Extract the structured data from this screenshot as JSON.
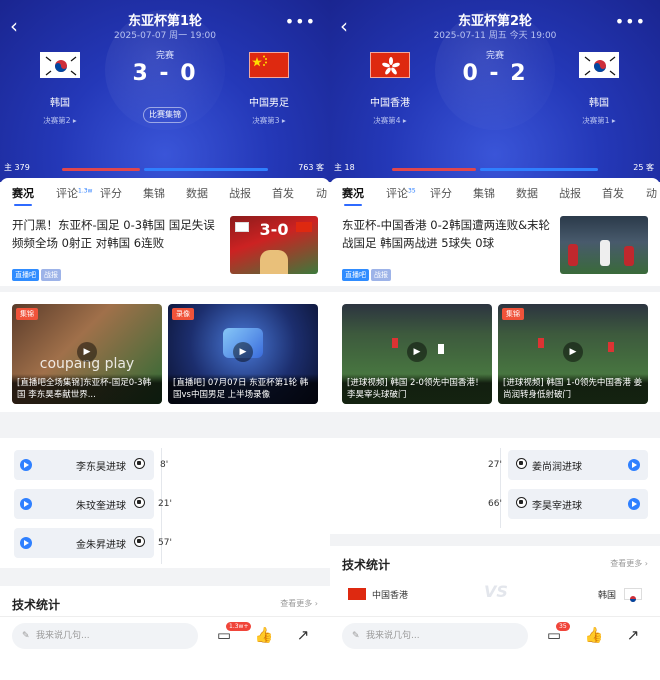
{
  "panels": [
    {
      "header": {
        "title": "东亚杯第1轮",
        "date": "2025-07-07 周一 19:00",
        "status": "完赛",
        "score": "3 - 0",
        "highlights": "比赛集锦",
        "home": {
          "name": "韩国",
          "sub": "决赛第2 ▸",
          "flag": "korea"
        },
        "away": {
          "name": "中国男足",
          "sub": "决赛第3 ▸",
          "flag": "china"
        }
      },
      "votes": {
        "left": "主 379",
        "right": "763 客",
        "left_share": 0.33
      },
      "tabs": [
        {
          "label": "赛况",
          "sup": ""
        },
        {
          "label": "评论",
          "sup": "1.3w"
        },
        {
          "label": "评分",
          "sup": ""
        },
        {
          "label": "集锦",
          "sup": ""
        },
        {
          "label": "数据",
          "sup": ""
        },
        {
          "label": "战报",
          "sup": ""
        },
        {
          "label": "首发",
          "sup": ""
        },
        {
          "label": "动",
          "sup": ""
        }
      ],
      "news": {
        "title": "开门黑！东亚杯-国足 0-3韩国 国足失误频频全场 0射正 对韩国 6连败",
        "tags": [
          "直播吧",
          "战报"
        ],
        "thumb_text": "3-0"
      },
      "videos": [
        {
          "badge": "集锦",
          "caption": "[直播吧全场集锦]东亚杯-国足0-3韩国 李东昊奉献世界...",
          "bg_text": "coupang play"
        },
        {
          "badge": "录像",
          "caption": "[直播吧] 07月07日 东亚杯第1轮 韩国vs中国男足 上半场录像",
          "bg_text": ""
        }
      ],
      "events": [
        {
          "text": "李东昊进球",
          "minute": "8'"
        },
        {
          "text": "朱玟奎进球",
          "minute": "21'"
        },
        {
          "text": "金朱昇进球",
          "minute": "57'"
        }
      ],
      "stats": {
        "title": "技术统计",
        "more": "查看更多 ›"
      },
      "bottom": {
        "placeholder": "我来说几句...",
        "comment_badge": "1.3w+"
      }
    },
    {
      "header": {
        "title": "东亚杯第2轮",
        "date": "2025-07-11 周五 今天 19:00",
        "status": "完赛",
        "score": "0 - 2",
        "highlights": "",
        "home": {
          "name": "中国香港",
          "sub": "决赛第4 ▸",
          "flag": "hongkong"
        },
        "away": {
          "name": "韩国",
          "sub": "决赛第1 ▸",
          "flag": "korea"
        }
      },
      "votes": {
        "left": "主 18",
        "right": "25 客",
        "left_share": 0.42
      },
      "tabs": [
        {
          "label": "赛况",
          "sup": ""
        },
        {
          "label": "评论",
          "sup": "35"
        },
        {
          "label": "评分",
          "sup": ""
        },
        {
          "label": "集锦",
          "sup": ""
        },
        {
          "label": "数据",
          "sup": ""
        },
        {
          "label": "战报",
          "sup": ""
        },
        {
          "label": "首发",
          "sup": ""
        },
        {
          "label": "动",
          "sup": ""
        }
      ],
      "news": {
        "title": "东亚杯-中国香港 0-2韩国遭两连败&末轮战国足 韩国两战进 5球失 0球",
        "tags": [
          "直播吧",
          "战报"
        ],
        "thumb_text": ""
      },
      "videos": [
        {
          "badge": "",
          "caption": "[进球视频] 韩国 2-0领先中国香港！李昊宰头球破门",
          "bg_text": ""
        },
        {
          "badge": "集锦",
          "caption": "[进球视频] 韩国 1-0领先中国香港 姜尚润转身低射破门",
          "bg_text": ""
        }
      ],
      "events": [
        {
          "text": "姜尚润进球",
          "minute": "27'"
        },
        {
          "text": "李昊宰进球",
          "minute": "66'"
        }
      ],
      "stats": {
        "title": "技术统计",
        "more": "查看更多 ›",
        "home": "中国香港",
        "away": "韩国"
      },
      "bottom": {
        "placeholder": "我来说几句...",
        "comment_badge": "35"
      }
    }
  ],
  "colors": {
    "header": "#2438b8",
    "accent": "#2f80ff",
    "home_bar": "#e0474c",
    "away_bar": "#2f80ff"
  }
}
